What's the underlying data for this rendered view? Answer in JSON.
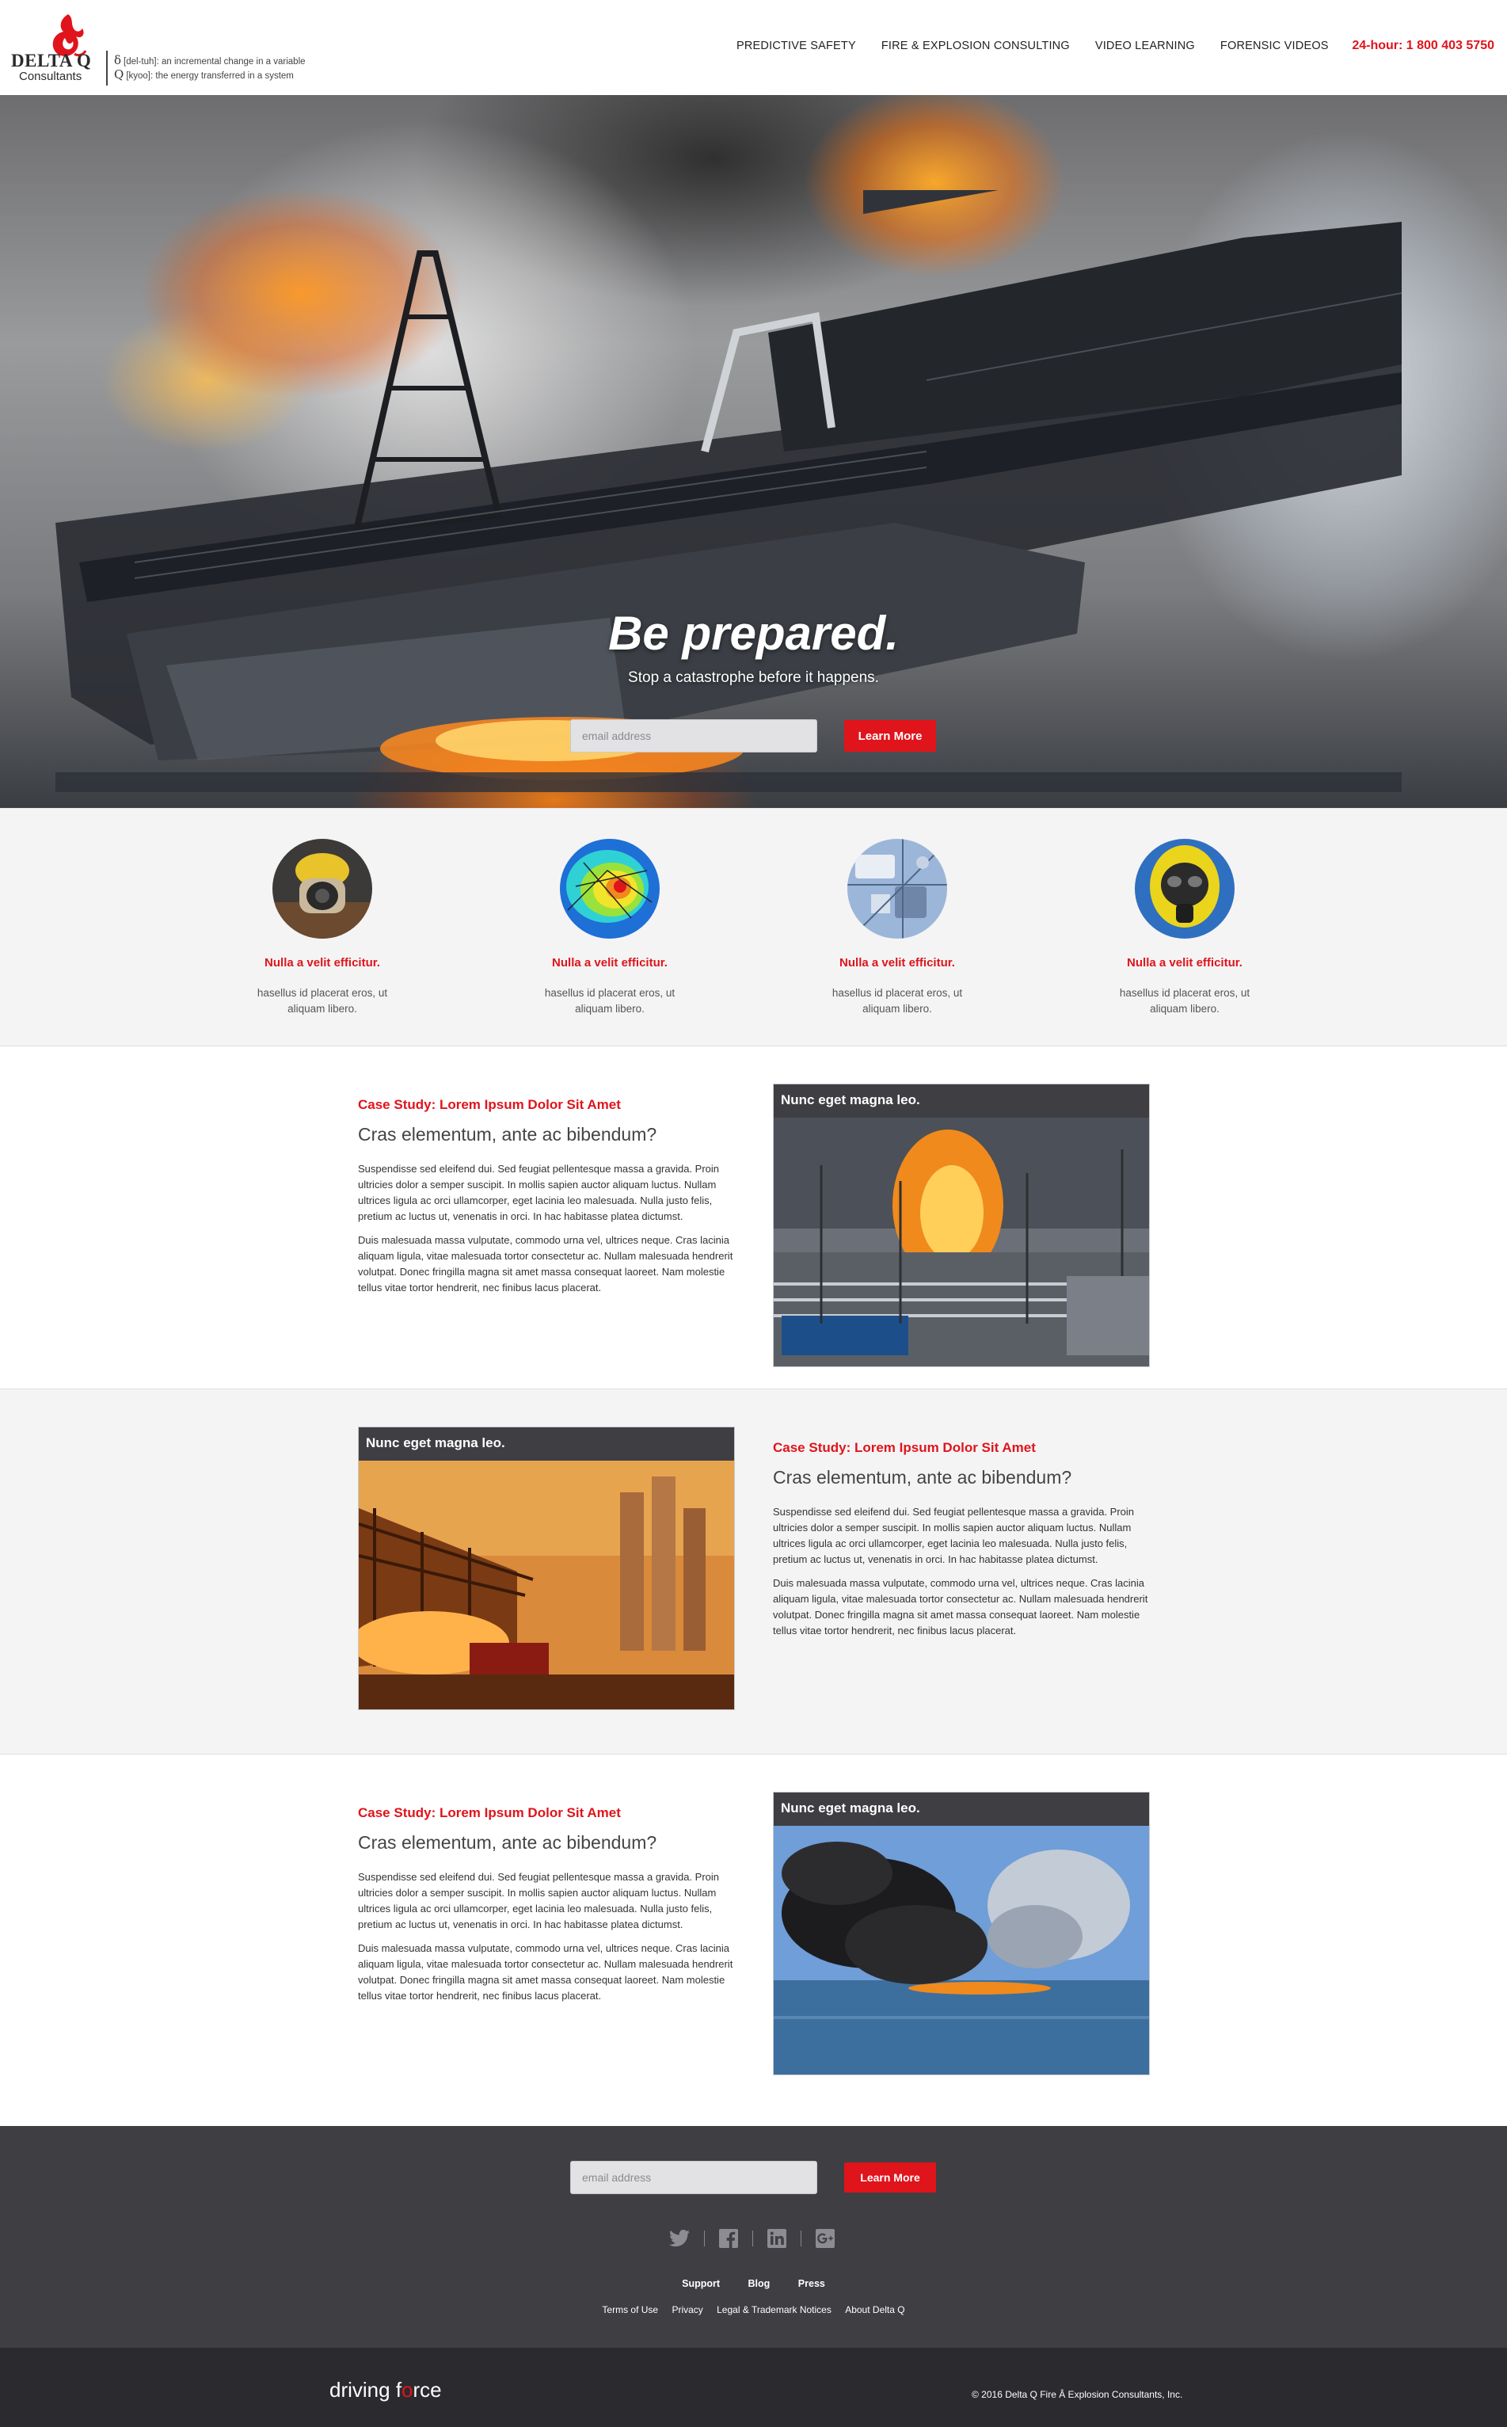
{
  "header": {
    "brand": "DELTA Q",
    "brand_sub": "Consultants",
    "def1_symbol": "δ",
    "def1_text": "[del-tuh]: an incremental change in a variable",
    "def2_symbol": "Q",
    "def2_text": "[kyoo]: the energy transferred in a system",
    "nav": [
      "PREDICTIVE SAFETY",
      "FIRE & EXPLOSION CONSULTING",
      "VIDEO LEARNING",
      "FORENSIC VIDEOS"
    ],
    "hotline": "24-hour: 1 800 403 5750"
  },
  "hero": {
    "title": "Be prepared.",
    "subtitle": "Stop a catastrophe before it happens.",
    "email_placeholder": "email address",
    "button": "Learn More"
  },
  "features": [
    {
      "icon": "firefighter-photo",
      "title": "Nulla a velit efficitur.",
      "text": "hasellus id placerat eros, ut aliquam libero."
    },
    {
      "icon": "heatmap-simulation",
      "title": "Nulla a velit efficitur.",
      "text": "hasellus id placerat eros, ut aliquam libero."
    },
    {
      "icon": "circuit-board",
      "title": "Nulla a velit efficitur.",
      "text": "hasellus id placerat eros, ut aliquam libero."
    },
    {
      "icon": "hazmat-mask",
      "title": "Nulla a velit efficitur.",
      "text": "hasellus id placerat eros, ut aliquam libero."
    }
  ],
  "cases": [
    {
      "kicker": "Case Study: Lorem Ipsum Dolor Sit Amet",
      "heading": "Cras elementum, ante ac bibendum?",
      "p1": "Suspendisse sed eleifend dui. Sed feugiat pellentesque massa a gravida. Proin ultricies dolor a semper suscipit. In mollis sapien auctor aliquam luctus. Nullam ultrices ligula ac orci ullamcorper, eget lacinia leo malesuada. Nulla justo felis, pretium ac luctus ut, venenatis in orci. In hac habitasse platea dictumst.",
      "p2": "Duis malesuada massa vulputate, commodo urna vel, ultrices neque. Cras lacinia aliquam ligula, vitae malesuada tortor consectetur ac. Nullam malesuada hendrerit volutpat. Donec fringilla magna sit amet massa consequat laoreet. Nam molestie tellus vitae tortor hendrerit, nec finibus lacus placerat.",
      "card_title": "Nunc eget magna leo."
    },
    {
      "kicker": "Case Study: Lorem Ipsum Dolor Sit Amet",
      "heading": "Cras elementum, ante ac bibendum?",
      "p1": "Suspendisse sed eleifend dui. Sed feugiat pellentesque massa a gravida. Proin ultricies dolor a semper suscipit. In mollis sapien auctor aliquam luctus. Nullam ultrices ligula ac orci ullamcorper, eget lacinia leo malesuada. Nulla justo felis, pretium ac luctus ut, venenatis in orci. In hac habitasse platea dictumst.",
      "p2": "Duis malesuada massa vulputate, commodo urna vel, ultrices neque. Cras lacinia aliquam ligula, vitae malesuada tortor consectetur ac. Nullam malesuada hendrerit volutpat. Donec fringilla magna sit amet massa consequat laoreet. Nam molestie tellus vitae tortor hendrerit, nec finibus lacus placerat.",
      "card_title": "Nunc eget magna leo."
    },
    {
      "kicker": "Case Study: Lorem Ipsum Dolor Sit Amet",
      "heading": "Cras elementum, ante ac bibendum?",
      "p1": "Suspendisse sed eleifend dui. Sed feugiat pellentesque massa a gravida. Proin ultricies dolor a semper suscipit. In mollis sapien auctor aliquam luctus. Nullam ultrices ligula ac orci ullamcorper, eget lacinia leo malesuada. Nulla justo felis, pretium ac luctus ut, venenatis in orci. In hac habitasse platea dictumst.",
      "p2": "Duis malesuada massa vulputate, commodo urna vel, ultrices neque. Cras lacinia aliquam ligula, vitae malesuada tortor consectetur ac. Nullam malesuada hendrerit volutpat. Donec fringilla magna sit amet massa consequat laoreet. Nam molestie tellus vitae tortor hendrerit, nec finibus lacus placerat.",
      "card_title": "Nunc eget magna leo."
    }
  ],
  "footer": {
    "email_placeholder": "email address",
    "button": "Learn More",
    "social": [
      "twitter-icon",
      "facebook-icon",
      "linkedin-icon",
      "google-plus-icon"
    ],
    "links": [
      "Support",
      "Blog",
      "Press"
    ],
    "legal": [
      "Terms of Use",
      "Privacy",
      "Legal & Trademark Notices",
      "About Delta Q"
    ],
    "brand_pre": "driving f",
    "brand_o": "o",
    "brand_post": "rce",
    "copyright": "© 2016 Delta Q Fire Â Explosion Consultants, Inc."
  },
  "colors": {
    "accent": "#e0141b",
    "footer_bg": "#3f3e43",
    "bottom_bg": "#2b2a2f",
    "section_gray": "#f4f4f5"
  }
}
